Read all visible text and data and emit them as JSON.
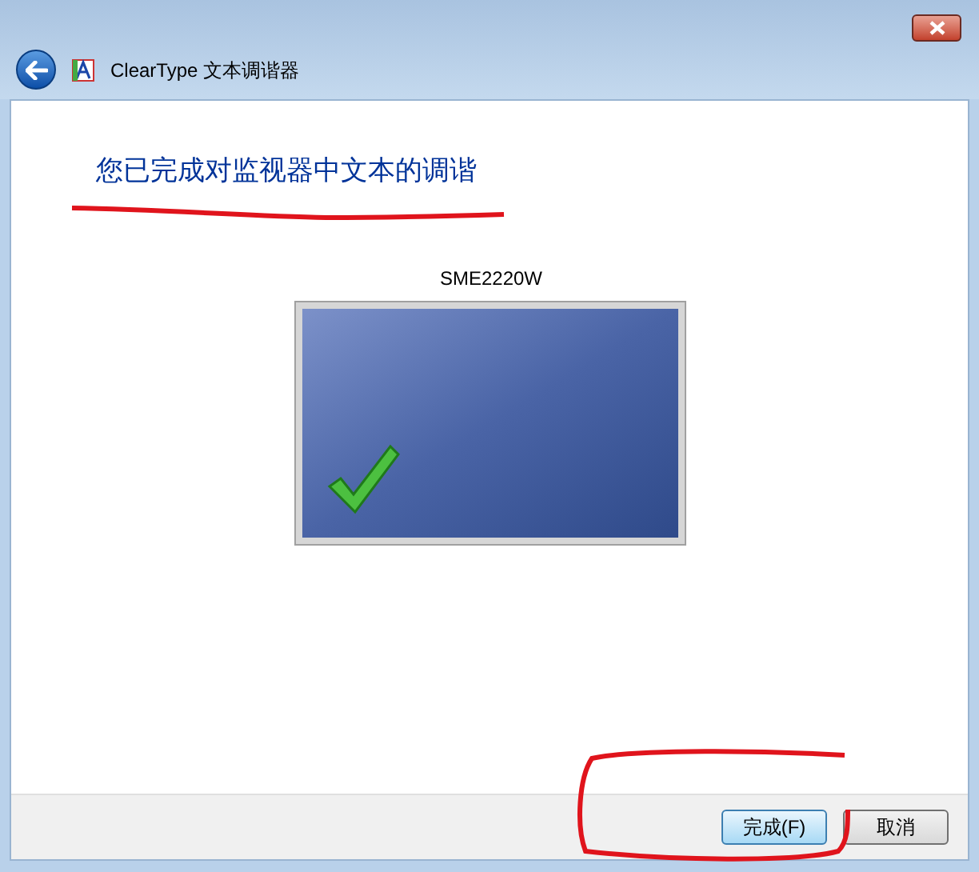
{
  "window": {
    "title": "ClearType 文本调谐器"
  },
  "heading": "您已完成对监视器中文本的调谐",
  "monitor": {
    "name": "SME2220W",
    "done": true
  },
  "buttons": [
    {
      "label": "完成(F)",
      "default": true
    },
    {
      "label": "取消",
      "default": false
    }
  ]
}
